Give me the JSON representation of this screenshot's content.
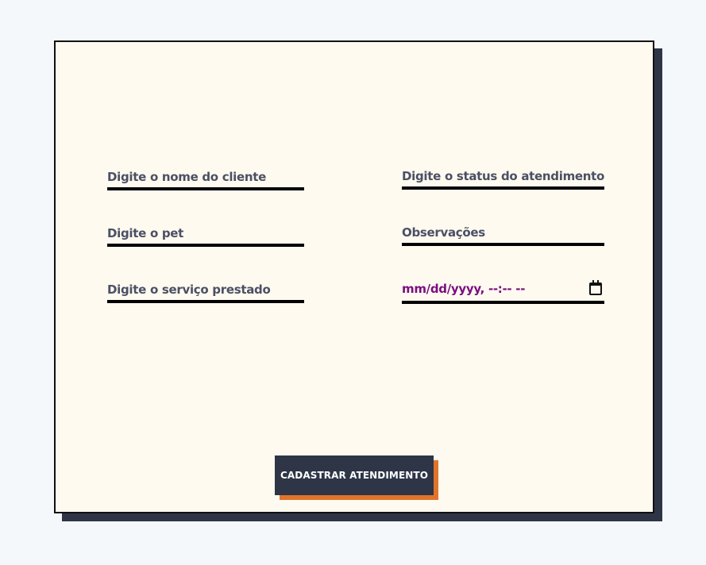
{
  "form": {
    "client_name_placeholder": "Digite o nome do cliente",
    "status_placeholder": "Digite o status do atendimento",
    "pet_placeholder": "Digite o pet",
    "notes_placeholder": "Observações",
    "service_placeholder": "Digite o serviço prestado",
    "datetime_placeholder": "mm/dd/yyyy, --:-- --",
    "submit_label": "CADASTRAR ATENDIMENTO"
  },
  "icons": {
    "datetime_picker": "calendar-icon"
  },
  "colors": {
    "page_background": "#f5f8fb",
    "card_background": "#fffaf0",
    "card_shadow": "#2d3547",
    "button_background": "#2d3547",
    "button_shadow": "#e0742c",
    "placeholder_text": "#4a5064",
    "date_text": "#7a0e80"
  }
}
